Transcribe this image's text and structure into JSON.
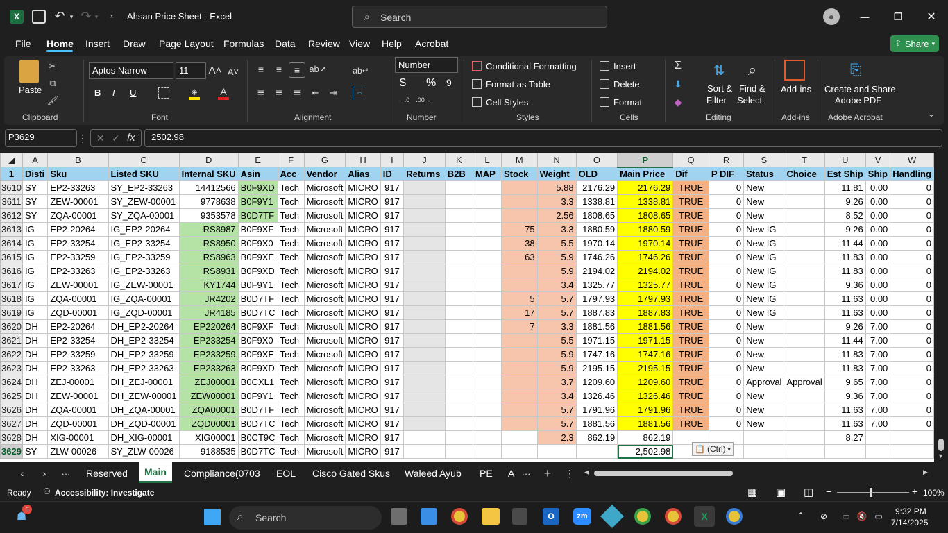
{
  "window": {
    "title": "Ahsan Price Sheet  -  Excel",
    "search_placeholder": "Search",
    "minimize": "—",
    "maximize": "❐",
    "close": "✕"
  },
  "menu": [
    "File",
    "Home",
    "Insert",
    "Draw",
    "Page Layout",
    "Formulas",
    "Data",
    "Review",
    "View",
    "Help",
    "Acrobat"
  ],
  "share_label": "Share",
  "ribbon": {
    "clipboard": {
      "paste": "Paste",
      "group": "Clipboard"
    },
    "font": {
      "name": "Aptos Narrow",
      "size": "11",
      "group": "Font",
      "bold": "B",
      "italic": "I",
      "underline": "U"
    },
    "alignment": {
      "group": "Alignment"
    },
    "number": {
      "format": "Number",
      "group": "Number",
      "currency": "$",
      "percent": "%",
      "comma": "9"
    },
    "styles": {
      "conditional": "Conditional Formatting",
      "format_table": "Format as Table",
      "cell_styles": "Cell Styles",
      "group": "Styles"
    },
    "cells": {
      "insert": "Insert",
      "delete": "Delete",
      "format": "Format",
      "group": "Cells"
    },
    "editing": {
      "sort": "Sort &",
      "sort2": "Filter",
      "find": "Find &",
      "find2": "Select",
      "group": "Editing"
    },
    "addins": {
      "label": "Add-ins",
      "group": "Add-ins"
    },
    "acrobat": {
      "label": "Create and Share",
      "label2": "Adobe PDF",
      "group": "Adobe Acrobat"
    }
  },
  "formula_bar": {
    "name_box": "P3629",
    "value": "2502.98"
  },
  "columns": [
    "A",
    "B",
    "C",
    "D",
    "E",
    "F",
    "G",
    "H",
    "I",
    "J",
    "K",
    "L",
    "M",
    "N",
    "O",
    "P",
    "Q",
    "R",
    "S",
    "T",
    "U",
    "V",
    "W"
  ],
  "header_row": {
    "num": "1",
    "cells": [
      "Disti",
      "Sku",
      "Listed SKU",
      "Internal SKU",
      "Asin",
      "Acc",
      "Vendor",
      "Alias",
      "ID",
      "Returns",
      "B2B",
      "MAP",
      "Stock",
      "Weight",
      "OLD",
      "Main Price",
      "Dif",
      "P DIF",
      "Status",
      "Choice",
      "Est Ship",
      "Ship",
      "Handling"
    ]
  },
  "rows": [
    [
      "3610",
      "SY",
      "EP2-33263",
      "SY_EP2-33263",
      "14412566",
      "B0F9XD",
      "Tech",
      "Microsoft",
      "MICRO",
      "917",
      "",
      "",
      "",
      "",
      "5.88",
      "2176.29",
      "2176.29",
      "TRUE",
      "0",
      "New",
      "",
      "11.81",
      "0.00",
      "0"
    ],
    [
      "3611",
      "SY",
      "ZEW-00001",
      "SY_ZEW-00001",
      "9778638",
      "B0F9Y1",
      "Tech",
      "Microsoft",
      "MICRO",
      "917",
      "",
      "",
      "",
      "",
      "3.3",
      "1338.81",
      "1338.81",
      "TRUE",
      "0",
      "New",
      "",
      "9.26",
      "0.00",
      "0"
    ],
    [
      "3612",
      "SY",
      "ZQA-00001",
      "SY_ZQA-00001",
      "9353578",
      "B0D7TF",
      "Tech",
      "Microsoft",
      "MICRO",
      "917",
      "",
      "",
      "",
      "",
      "2.56",
      "1808.65",
      "1808.65",
      "TRUE",
      "0",
      "New",
      "",
      "8.52",
      "0.00",
      "0"
    ],
    [
      "3613",
      "IG",
      "EP2-20264",
      "IG_EP2-20264",
      "RS8987",
      "B0F9XF",
      "Tech",
      "Microsoft",
      "MICRO",
      "917",
      "",
      "",
      "",
      "75",
      "3.3",
      "1880.59",
      "1880.59",
      "TRUE",
      "0",
      "New IG",
      "",
      "9.26",
      "0.00",
      "0"
    ],
    [
      "3614",
      "IG",
      "EP2-33254",
      "IG_EP2-33254",
      "RS8950",
      "B0F9X0",
      "Tech",
      "Microsoft",
      "MICRO",
      "917",
      "",
      "",
      "",
      "38",
      "5.5",
      "1970.14",
      "1970.14",
      "TRUE",
      "0",
      "New IG",
      "",
      "11.44",
      "0.00",
      "0"
    ],
    [
      "3615",
      "IG",
      "EP2-33259",
      "IG_EP2-33259",
      "RS8963",
      "B0F9XE",
      "Tech",
      "Microsoft",
      "MICRO",
      "917",
      "",
      "",
      "",
      "63",
      "5.9",
      "1746.26",
      "1746.26",
      "TRUE",
      "0",
      "New IG",
      "",
      "11.83",
      "0.00",
      "0"
    ],
    [
      "3616",
      "IG",
      "EP2-33263",
      "IG_EP2-33263",
      "RS8931",
      "B0F9XD",
      "Tech",
      "Microsoft",
      "MICRO",
      "917",
      "",
      "",
      "",
      "",
      "5.9",
      "2194.02",
      "2194.02",
      "TRUE",
      "0",
      "New IG",
      "",
      "11.83",
      "0.00",
      "0"
    ],
    [
      "3617",
      "IG",
      "ZEW-00001",
      "IG_ZEW-00001",
      "KY1744",
      "B0F9Y1",
      "Tech",
      "Microsoft",
      "MICRO",
      "917",
      "",
      "",
      "",
      "",
      "3.4",
      "1325.77",
      "1325.77",
      "TRUE",
      "0",
      "New IG",
      "",
      "9.36",
      "0.00",
      "0"
    ],
    [
      "3618",
      "IG",
      "ZQA-00001",
      "IG_ZQA-00001",
      "JR4202",
      "B0D7TF",
      "Tech",
      "Microsoft",
      "MICRO",
      "917",
      "",
      "",
      "",
      "5",
      "5.7",
      "1797.93",
      "1797.93",
      "TRUE",
      "0",
      "New IG",
      "",
      "11.63",
      "0.00",
      "0"
    ],
    [
      "3619",
      "IG",
      "ZQD-00001",
      "IG_ZQD-00001",
      "JR4185",
      "B0D7TC",
      "Tech",
      "Microsoft",
      "MICRO",
      "917",
      "",
      "",
      "",
      "17",
      "5.7",
      "1887.83",
      "1887.83",
      "TRUE",
      "0",
      "New IG",
      "",
      "11.63",
      "0.00",
      "0"
    ],
    [
      "3620",
      "DH",
      "EP2-20264",
      "DH_EP2-20264",
      "EP220264",
      "B0F9XF",
      "Tech",
      "Microsoft",
      "MICRO",
      "917",
      "",
      "",
      "",
      "7",
      "3.3",
      "1881.56",
      "1881.56",
      "TRUE",
      "0",
      "New",
      "",
      "9.26",
      "7.00",
      "0"
    ],
    [
      "3621",
      "DH",
      "EP2-33254",
      "DH_EP2-33254",
      "EP233254",
      "B0F9X0",
      "Tech",
      "Microsoft",
      "MICRO",
      "917",
      "",
      "",
      "",
      "",
      "5.5",
      "1971.15",
      "1971.15",
      "TRUE",
      "0",
      "New",
      "",
      "11.44",
      "7.00",
      "0"
    ],
    [
      "3622",
      "DH",
      "EP2-33259",
      "DH_EP2-33259",
      "EP233259",
      "B0F9XE",
      "Tech",
      "Microsoft",
      "MICRO",
      "917",
      "",
      "",
      "",
      "",
      "5.9",
      "1747.16",
      "1747.16",
      "TRUE",
      "0",
      "New",
      "",
      "11.83",
      "7.00",
      "0"
    ],
    [
      "3623",
      "DH",
      "EP2-33263",
      "DH_EP2-33263",
      "EP233263",
      "B0F9XD",
      "Tech",
      "Microsoft",
      "MICRO",
      "917",
      "",
      "",
      "",
      "",
      "5.9",
      "2195.15",
      "2195.15",
      "TRUE",
      "0",
      "New",
      "",
      "11.83",
      "7.00",
      "0"
    ],
    [
      "3624",
      "DH",
      "ZEJ-00001",
      "DH_ZEJ-00001",
      "ZEJ00001",
      "B0CXL1",
      "Tech",
      "Microsoft",
      "MICRO",
      "917",
      "",
      "",
      "",
      "",
      "3.7",
      "1209.60",
      "1209.60",
      "TRUE",
      "0",
      "Approval",
      "Approval",
      "9.65",
      "7.00",
      "0"
    ],
    [
      "3625",
      "DH",
      "ZEW-00001",
      "DH_ZEW-00001",
      "ZEW00001",
      "B0F9Y1",
      "Tech",
      "Microsoft",
      "MICRO",
      "917",
      "",
      "",
      "",
      "",
      "3.4",
      "1326.46",
      "1326.46",
      "TRUE",
      "0",
      "New",
      "",
      "9.36",
      "7.00",
      "0"
    ],
    [
      "3626",
      "DH",
      "ZQA-00001",
      "DH_ZQA-00001",
      "ZQA00001",
      "B0D7TF",
      "Tech",
      "Microsoft",
      "MICRO",
      "917",
      "",
      "",
      "",
      "",
      "5.7",
      "1791.96",
      "1791.96",
      "TRUE",
      "0",
      "New",
      "",
      "11.63",
      "7.00",
      "0"
    ],
    [
      "3627",
      "DH",
      "ZQD-00001",
      "DH_ZQD-00001",
      "ZQD00001",
      "B0D7TC",
      "Tech",
      "Microsoft",
      "MICRO",
      "917",
      "",
      "",
      "",
      "",
      "5.7",
      "1881.56",
      "1881.56",
      "TRUE",
      "0",
      "New",
      "",
      "11.63",
      "7.00",
      "0"
    ],
    [
      "3628",
      "DH",
      "XIG-00001",
      "DH_XIG-00001",
      "XIG00001",
      "B0CT9C",
      "Tech",
      "Microsoft",
      "MICRO",
      "917",
      "",
      "",
      "",
      "",
      "2.3",
      "862.19",
      "862.19",
      "",
      "",
      "",
      "",
      "8.27",
      "",
      ""
    ],
    [
      "3629",
      "SY",
      "ZLW-00026",
      "SY_ZLW-00026",
      "9188535",
      "B0D7TC",
      "Tech",
      "Microsoft",
      "MICRO",
      "917",
      "",
      "",
      "",
      "",
      "",
      "",
      "2,502.98",
      "",
      "",
      "",
      "",
      "",
      "",
      ""
    ]
  ],
  "paste_ctrl": "(Ctrl)",
  "sheets": [
    "Reserved",
    "Main",
    "Compliance(0703",
    "EOL",
    "Cisco Gated Skus",
    "Waleed Ayub",
    "PE",
    "A"
  ],
  "status": {
    "ready": "Ready",
    "accessibility": "Accessibility: Investigate",
    "zoom": "100%"
  },
  "taskbar": {
    "search": "Search",
    "time": "9:32 PM",
    "date": "7/14/2025",
    "badge": "6"
  }
}
